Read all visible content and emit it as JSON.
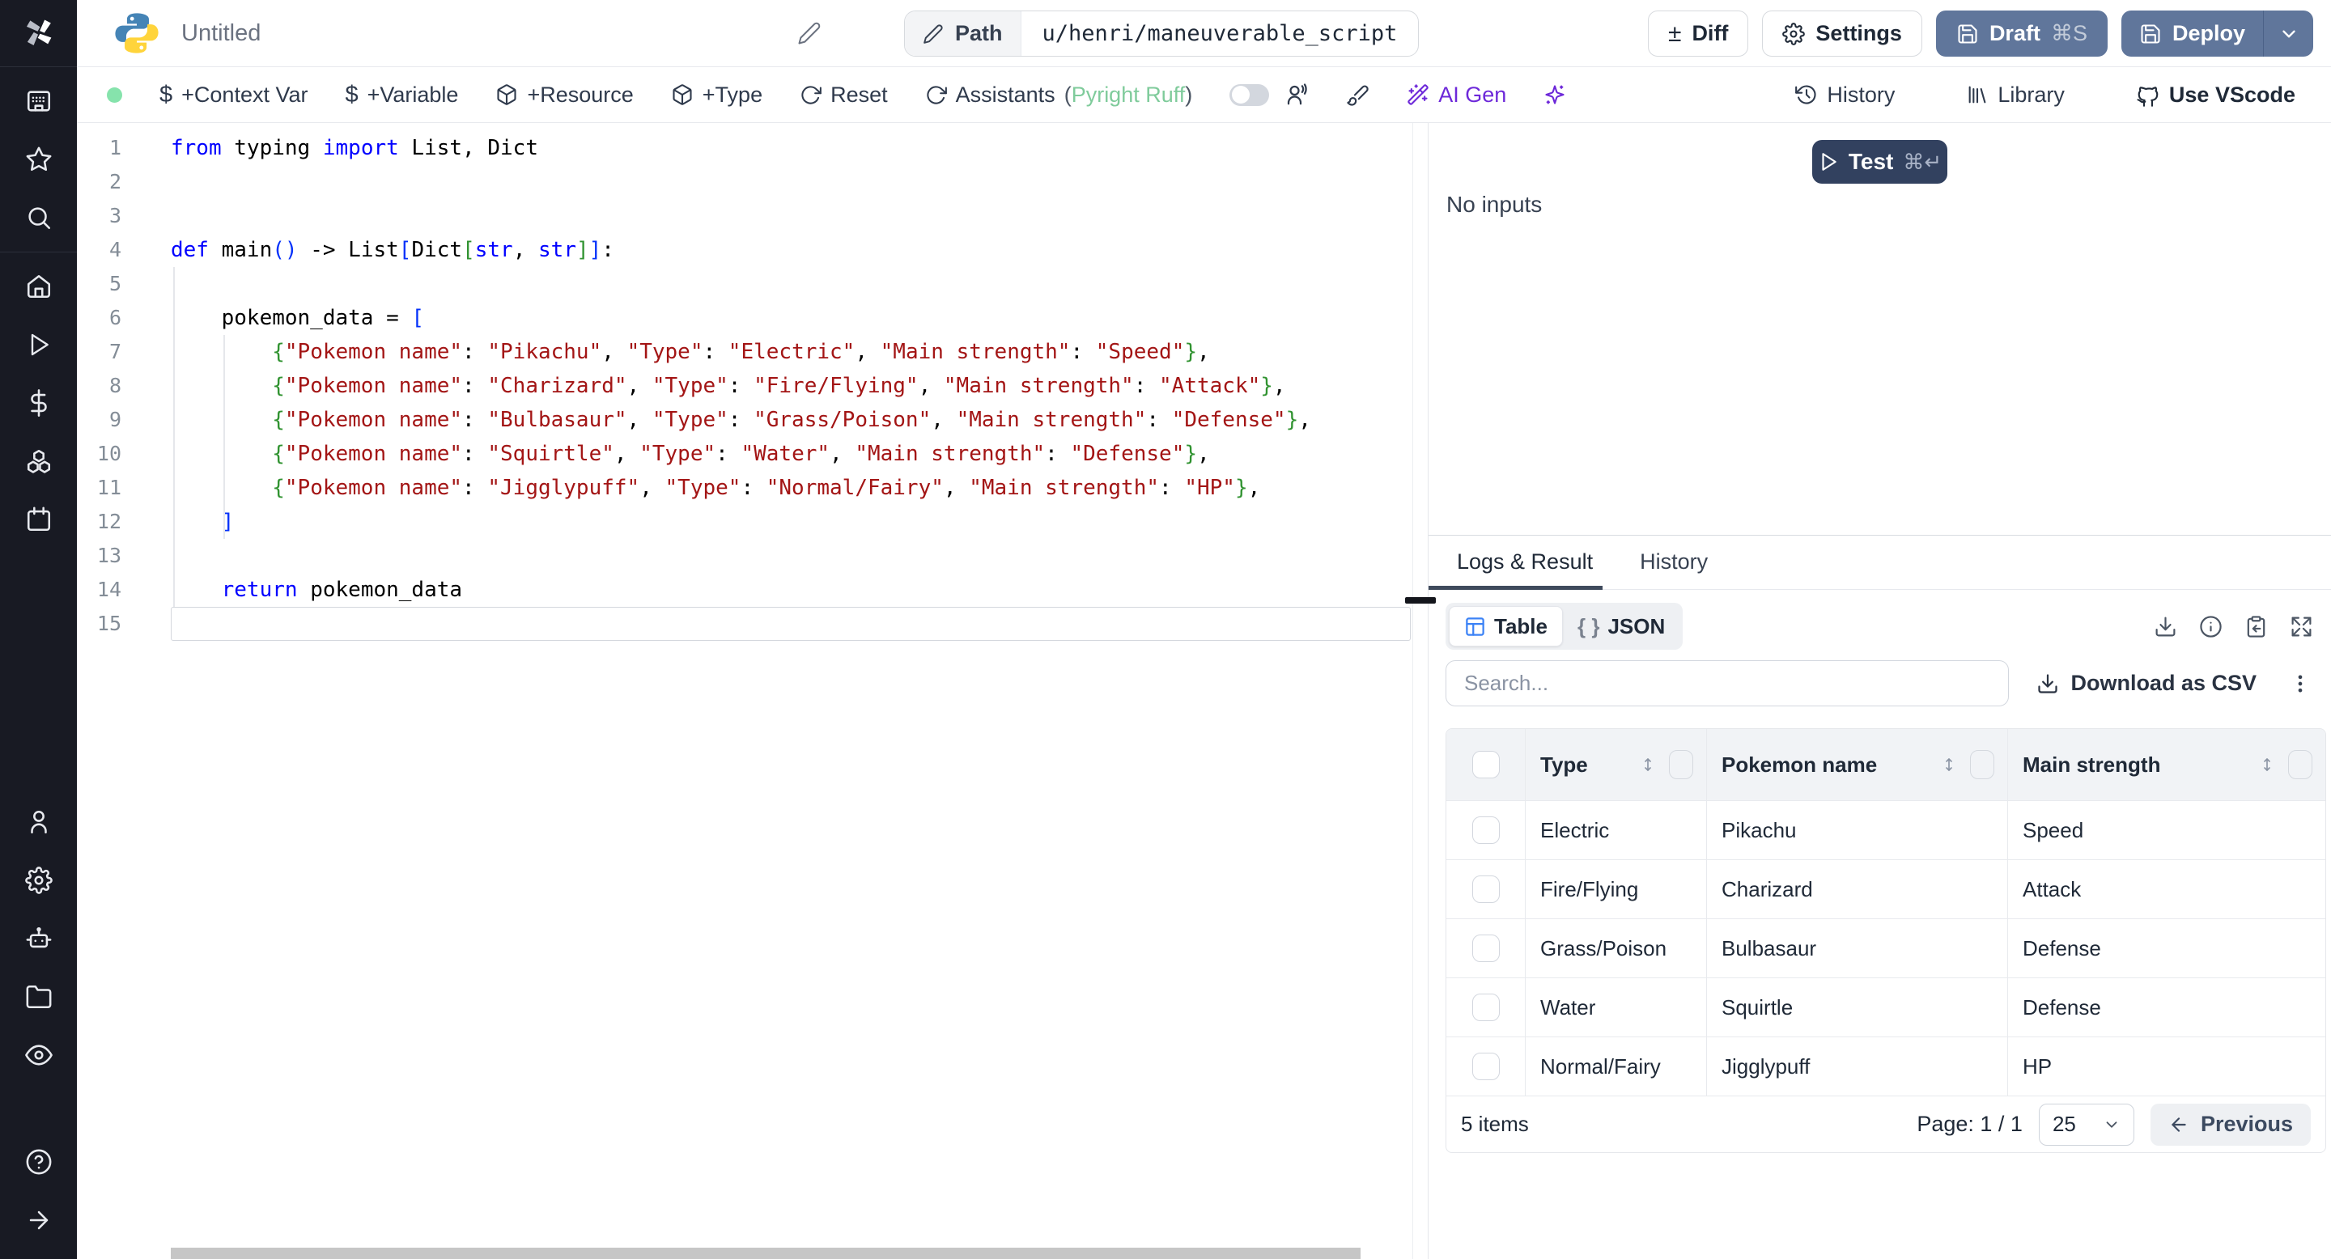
{
  "header": {
    "title": "Untitled",
    "path_label": "Path",
    "path_value": "u/henri/maneuverable_script",
    "diff_label": "Diff",
    "settings_label": "Settings",
    "draft_label": "Draft",
    "draft_shortcut": "⌘S",
    "deploy_label": "Deploy"
  },
  "toolbar": {
    "context_var": "+Context Var",
    "variable": "+Variable",
    "resource": "+Resource",
    "type": "+Type",
    "reset": "Reset",
    "assistants": "Assistants",
    "assistants_status_open": "(",
    "assistants_status": "Pyright Ruff",
    "assistants_status_close": ")",
    "ai_gen": "AI Gen",
    "history": "History",
    "library": "Library",
    "vscode": "Use VScode"
  },
  "sidebar": {
    "top_icons": [
      "app-window",
      "star",
      "search"
    ],
    "mid_icons": [
      "home",
      "play",
      "dollar",
      "cubes",
      "calendar"
    ],
    "bottom_icons": [
      "user",
      "gear",
      "robot",
      "folder",
      "eye"
    ],
    "foot_icons": [
      "help",
      "arrow-right"
    ]
  },
  "editor": {
    "lines": [
      {
        "n": 1,
        "tokens": [
          [
            "kw",
            "from"
          ],
          [
            "pl",
            " typing "
          ],
          [
            "kw",
            "import"
          ],
          [
            "pl",
            " List, Dict"
          ]
        ]
      },
      {
        "n": 2,
        "tokens": []
      },
      {
        "n": 3,
        "tokens": []
      },
      {
        "n": 4,
        "tokens": [
          [
            "kw",
            "def"
          ],
          [
            "pl",
            " main"
          ],
          [
            "b1",
            "()"
          ],
          [
            "pl",
            " -> List"
          ],
          [
            "b1",
            "["
          ],
          [
            "pl",
            "Dict"
          ],
          [
            "b2",
            "["
          ],
          [
            "kw",
            "str"
          ],
          [
            "pl",
            ", "
          ],
          [
            "kw",
            "str"
          ],
          [
            "b2",
            "]"
          ],
          [
            "b1",
            "]"
          ],
          [
            "pl",
            ":"
          ]
        ]
      },
      {
        "n": 5,
        "tokens": []
      },
      {
        "n": 6,
        "tokens": [
          [
            "pl",
            "    pokemon_data = "
          ],
          [
            "b1",
            "["
          ]
        ]
      },
      {
        "n": 7,
        "tokens": [
          [
            "pl",
            "        "
          ],
          [
            "b2",
            "{"
          ],
          [
            "str",
            "\"Pokemon name\""
          ],
          [
            "pl",
            ": "
          ],
          [
            "str",
            "\"Pikachu\""
          ],
          [
            "pl",
            ", "
          ],
          [
            "str",
            "\"Type\""
          ],
          [
            "pl",
            ": "
          ],
          [
            "str",
            "\"Electric\""
          ],
          [
            "pl",
            ", "
          ],
          [
            "str",
            "\"Main strength\""
          ],
          [
            "pl",
            ": "
          ],
          [
            "str",
            "\"Speed\""
          ],
          [
            "b2",
            "}"
          ],
          [
            "pl",
            ","
          ]
        ]
      },
      {
        "n": 8,
        "tokens": [
          [
            "pl",
            "        "
          ],
          [
            "b2",
            "{"
          ],
          [
            "str",
            "\"Pokemon name\""
          ],
          [
            "pl",
            ": "
          ],
          [
            "str",
            "\"Charizard\""
          ],
          [
            "pl",
            ", "
          ],
          [
            "str",
            "\"Type\""
          ],
          [
            "pl",
            ": "
          ],
          [
            "str",
            "\"Fire/Flying\""
          ],
          [
            "pl",
            ", "
          ],
          [
            "str",
            "\"Main strength\""
          ],
          [
            "pl",
            ": "
          ],
          [
            "str",
            "\"Attack\""
          ],
          [
            "b2",
            "}"
          ],
          [
            "pl",
            ","
          ]
        ]
      },
      {
        "n": 9,
        "tokens": [
          [
            "pl",
            "        "
          ],
          [
            "b2",
            "{"
          ],
          [
            "str",
            "\"Pokemon name\""
          ],
          [
            "pl",
            ": "
          ],
          [
            "str",
            "\"Bulbasaur\""
          ],
          [
            "pl",
            ", "
          ],
          [
            "str",
            "\"Type\""
          ],
          [
            "pl",
            ": "
          ],
          [
            "str",
            "\"Grass/Poison\""
          ],
          [
            "pl",
            ", "
          ],
          [
            "str",
            "\"Main strength\""
          ],
          [
            "pl",
            ": "
          ],
          [
            "str",
            "\"Defense\""
          ],
          [
            "b2",
            "}"
          ],
          [
            "pl",
            ","
          ]
        ]
      },
      {
        "n": 10,
        "tokens": [
          [
            "pl",
            "        "
          ],
          [
            "b2",
            "{"
          ],
          [
            "str",
            "\"Pokemon name\""
          ],
          [
            "pl",
            ": "
          ],
          [
            "str",
            "\"Squirtle\""
          ],
          [
            "pl",
            ", "
          ],
          [
            "str",
            "\"Type\""
          ],
          [
            "pl",
            ": "
          ],
          [
            "str",
            "\"Water\""
          ],
          [
            "pl",
            ", "
          ],
          [
            "str",
            "\"Main strength\""
          ],
          [
            "pl",
            ": "
          ],
          [
            "str",
            "\"Defense\""
          ],
          [
            "b2",
            "}"
          ],
          [
            "pl",
            ","
          ]
        ]
      },
      {
        "n": 11,
        "tokens": [
          [
            "pl",
            "        "
          ],
          [
            "b2",
            "{"
          ],
          [
            "str",
            "\"Pokemon name\""
          ],
          [
            "pl",
            ": "
          ],
          [
            "str",
            "\"Jigglypuff\""
          ],
          [
            "pl",
            ", "
          ],
          [
            "str",
            "\"Type\""
          ],
          [
            "pl",
            ": "
          ],
          [
            "str",
            "\"Normal/Fairy\""
          ],
          [
            "pl",
            ", "
          ],
          [
            "str",
            "\"Main strength\""
          ],
          [
            "pl",
            ": "
          ],
          [
            "str",
            "\"HP\""
          ],
          [
            "b2",
            "}"
          ],
          [
            "pl",
            ","
          ]
        ]
      },
      {
        "n": 12,
        "tokens": [
          [
            "pl",
            "    "
          ],
          [
            "b1",
            "]"
          ]
        ]
      },
      {
        "n": 13,
        "tokens": []
      },
      {
        "n": 14,
        "tokens": [
          [
            "pl",
            "    "
          ],
          [
            "kw",
            "return"
          ],
          [
            "pl",
            " pokemon_data"
          ]
        ]
      },
      {
        "n": 15,
        "tokens": [],
        "current": true
      }
    ]
  },
  "run": {
    "test_label": "Test",
    "test_shortcut": "⌘↵",
    "no_inputs": "No inputs"
  },
  "result_panel": {
    "tab_logs": "Logs & Result",
    "tab_history": "History",
    "view_table": "Table",
    "view_json": "JSON",
    "braces_glyph": "{ }",
    "search_placeholder": "Search...",
    "download_csv": "Download as CSV",
    "table": {
      "columns": [
        "Type",
        "Pokemon name",
        "Main strength"
      ],
      "rows": [
        [
          "Electric",
          "Pikachu",
          "Speed"
        ],
        [
          "Fire/Flying",
          "Charizard",
          "Attack"
        ],
        [
          "Grass/Poison",
          "Bulbasaur",
          "Defense"
        ],
        [
          "Water",
          "Squirtle",
          "Defense"
        ],
        [
          "Normal/Fairy",
          "Jigglypuff",
          "HP"
        ]
      ]
    },
    "footer": {
      "items_count": "5 items",
      "page_label": "Page: 1 / 1",
      "page_size": "25",
      "previous": "Previous"
    }
  },
  "colors": {
    "sidebar_bg": "#181a23",
    "primary_button": "#60769b",
    "test_button": "#32415f",
    "status_dot_green": "#86e3ac",
    "assistant_green": "#7fcb9b",
    "ai_purple": "#6d28d9",
    "table_icon_blue": "#3b82f6",
    "keyword_blue": "#0000ff",
    "string_red": "#a31515"
  }
}
